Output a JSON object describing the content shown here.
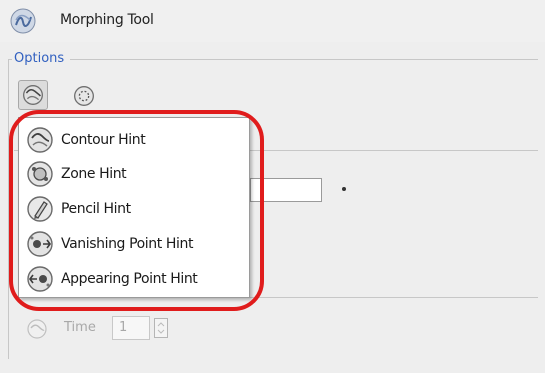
{
  "window": {
    "title": "Morphing Tool",
    "title_icon": "morphing-tool-icon"
  },
  "options": {
    "label": "Options",
    "accent_color": "#3160c0",
    "tools": [
      {
        "name": "contour-hint-tool",
        "icon": "contour-hint-icon",
        "pressed": true
      },
      {
        "name": "zone-hint-tool",
        "icon": "zone-hint-icon",
        "pressed": false
      }
    ]
  },
  "hint_menu": {
    "items": [
      {
        "label": "Contour Hint",
        "icon": "contour-hint-icon"
      },
      {
        "label": "Zone Hint",
        "icon": "zone-hint-icon"
      },
      {
        "label": "Pencil Hint",
        "icon": "pencil-hint-icon"
      },
      {
        "label": "Vanishing Point Hint",
        "icon": "vanishing-point-hint-icon"
      },
      {
        "label": "Appearing Point Hint",
        "icon": "appearing-point-hint-icon"
      }
    ],
    "highlight_color": "#e01c1c"
  },
  "time": {
    "label": "Time",
    "value": "1",
    "enabled": false
  }
}
